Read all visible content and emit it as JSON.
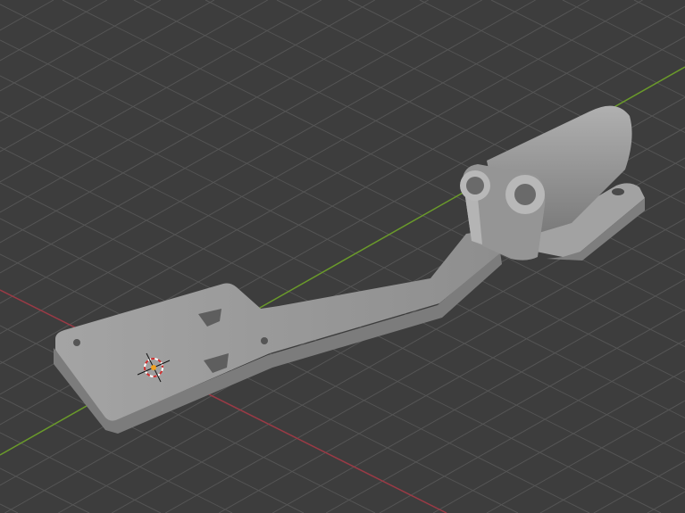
{
  "viewport": {
    "background_color": "#3d3d3d",
    "grid_color": "#555555",
    "x_axis_color": "#9a3a45",
    "y_axis_color": "#6a9a2a",
    "model_color": "#9e9e9e",
    "icons": [
      "3d-cursor-icon"
    ]
  }
}
